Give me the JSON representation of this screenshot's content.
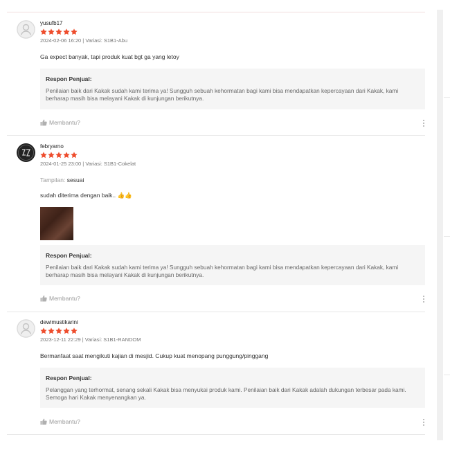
{
  "reviews": [
    {
      "username": "yusufb17",
      "meta": "2024-02-06 16:20 | Variasi: S1B1-Abu",
      "comment": "Ga expect banyak, tapi produk kuat bgt ga yang letoy",
      "rating": 5,
      "response_title": "Respon Penjual:",
      "response_text": "Penilaian baik dari Kakak sudah kami terima ya! Sungguh sebuah kehormatan bagi kami bisa mendapatkan kepercayaan dari Kakak, kami berharap masih bisa melayani Kakak di kunjungan berikutnya.",
      "helpful_label": "Membantu?"
    },
    {
      "username": "febryarno",
      "meta": "2024-01-25 23:00 | Variasi: S1B1-Cokelat",
      "attr_key": "Tampilan:",
      "attr_value": "sesuai",
      "comment": "sudah diterima dengan baik.. 👍👍",
      "rating": 5,
      "response_title": "Respon Penjual:",
      "response_text": "Penilaian baik dari Kakak sudah kami terima ya! Sungguh sebuah kehormatan bagi kami bisa mendapatkan kepercayaan dari Kakak, kami berharap masih bisa melayani Kakak di kunjungan berikutnya.",
      "helpful_label": "Membantu?"
    },
    {
      "username": "dewimustikarini",
      "meta": "2023-12-11 22:29 | Variasi: S1B1-RANDOM",
      "comment": "Bermanfaat saat mengikuti kajian di mesjid. Cukup kuat menopang punggung/pinggang",
      "rating": 5,
      "response_title": "Respon Penjual:",
      "response_text": "Pelanggan yang terhormat, senang sekali Kakak bisa menyukai produk kami. Penilaian baik dari Kakak adalah dukungan terbesar pada kami. Semoga hari Kakak menyenangkan ya.",
      "helpful_label": "Membantu?"
    }
  ],
  "colors": {
    "star": "#ee4d2d",
    "response_bg": "#f5f5f5",
    "muted_text": "#9a9a9a"
  }
}
